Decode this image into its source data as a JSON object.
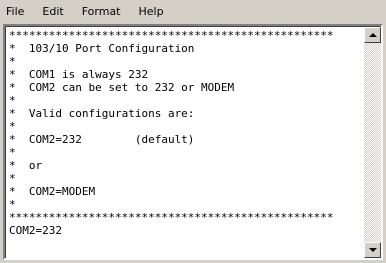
{
  "menu": [
    "File",
    "Edit",
    "Format",
    "Help"
  ],
  "lines": [
    "*************************************************",
    "*  103/10 Port Configuration",
    "*",
    "*  COM1 is always 232",
    "*  COM2 can be set to 232 or MODEM",
    "*",
    "*  Valid configurations are:",
    "*",
    "*  COM2=232        (default)",
    "*",
    "*  or",
    "*",
    "*  COM2=MODEM",
    "*",
    "*************************************************",
    "COM2=232"
  ]
}
